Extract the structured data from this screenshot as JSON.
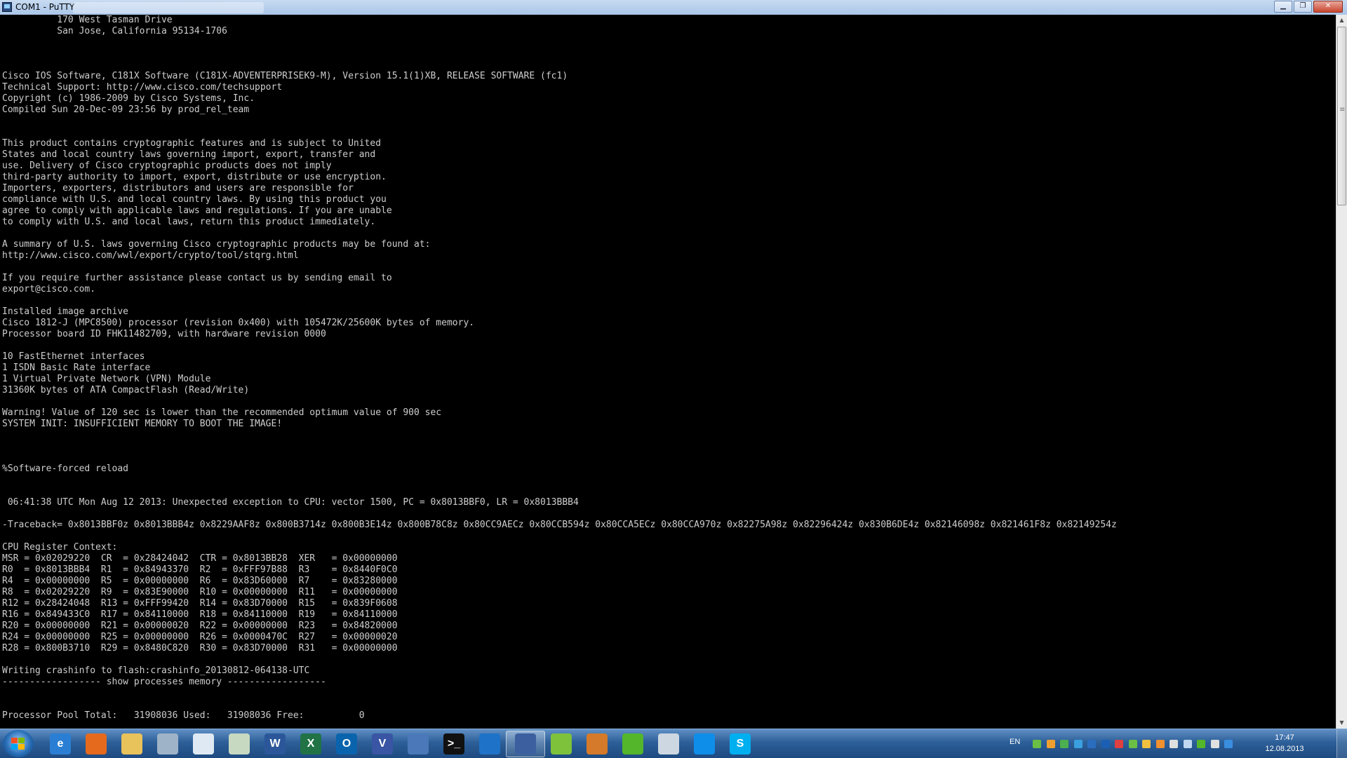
{
  "window": {
    "title": "COM1 - PuTTY"
  },
  "terminal": {
    "lines": [
      "          170 West Tasman Drive",
      "          San Jose, California 95134-1706",
      "",
      "",
      "",
      "Cisco IOS Software, C181X Software (C181X-ADVENTERPRISEK9-M), Version 15.1(1)XB, RELEASE SOFTWARE (fc1)",
      "Technical Support: http://www.cisco.com/techsupport",
      "Copyright (c) 1986-2009 by Cisco Systems, Inc.",
      "Compiled Sun 20-Dec-09 23:56 by prod_rel_team",
      "",
      "",
      "This product contains cryptographic features and is subject to United",
      "States and local country laws governing import, export, transfer and",
      "use. Delivery of Cisco cryptographic products does not imply",
      "third-party authority to import, export, distribute or use encryption.",
      "Importers, exporters, distributors and users are responsible for",
      "compliance with U.S. and local country laws. By using this product you",
      "agree to comply with applicable laws and regulations. If you are unable",
      "to comply with U.S. and local laws, return this product immediately.",
      "",
      "A summary of U.S. laws governing Cisco cryptographic products may be found at:",
      "http://www.cisco.com/wwl/export/crypto/tool/stqrg.html",
      "",
      "If you require further assistance please contact us by sending email to",
      "export@cisco.com.",
      "",
      "Installed image archive",
      "Cisco 1812-J (MPC8500) processor (revision 0x400) with 105472K/25600K bytes of memory.",
      "Processor board ID FHK11482709, with hardware revision 0000",
      "",
      "10 FastEthernet interfaces",
      "1 ISDN Basic Rate interface",
      "1 Virtual Private Network (VPN) Module",
      "31360K bytes of ATA CompactFlash (Read/Write)",
      "",
      "Warning! Value of 120 sec is lower than the recommended optimum value of 900 sec",
      "SYSTEM INIT: INSUFFICIENT MEMORY TO BOOT THE IMAGE!",
      "",
      "",
      "",
      "%Software-forced reload",
      "",
      "",
      " 06:41:38 UTC Mon Aug 12 2013: Unexpected exception to CPU: vector 1500, PC = 0x8013BBF0, LR = 0x8013BBB4",
      "",
      "-Traceback= 0x8013BBF0z 0x8013BBB4z 0x8229AAF8z 0x800B3714z 0x800B3E14z 0x800B78C8z 0x80CC9AECz 0x80CCB594z 0x80CCA5ECz 0x80CCA970z 0x82275A98z 0x82296424z 0x830B6DE4z 0x82146098z 0x821461F8z 0x82149254z",
      "",
      "CPU Register Context:",
      "MSR = 0x02029220  CR  = 0x28424042  CTR = 0x8013BB28  XER   = 0x00000000",
      "R0  = 0x8013BBB4  R1  = 0x84943370  R2  = 0xFFF97B88  R3    = 0x8440F0C0",
      "R4  = 0x00000000  R5  = 0x00000000  R6  = 0x83D60000  R7    = 0x83280000",
      "R8  = 0x02029220  R9  = 0x83E90000  R10 = 0x00000000  R11   = 0x00000000",
      "R12 = 0x28424048  R13 = 0xFFF99420  R14 = 0x83D70000  R15   = 0x839F0608",
      "R16 = 0x849433C0  R17 = 0x84110000  R18 = 0x84110000  R19   = 0x84110000",
      "R20 = 0x00000000  R21 = 0x00000020  R22 = 0x00000000  R23   = 0x84820000",
      "R24 = 0x00000000  R25 = 0x00000000  R26 = 0x0000470C  R27   = 0x00000020",
      "R28 = 0x800B3710  R29 = 0x8480C820  R30 = 0x83D70000  R31   = 0x00000000",
      "",
      "Writing crashinfo to flash:crashinfo_20130812-064138-UTC",
      "------------------ show processes memory ------------------",
      "",
      "",
      "Processor Pool Total:   31908036 Used:   31908036 Free:          0"
    ]
  },
  "taskbar": {
    "apps": [
      {
        "name": "internet-explorer",
        "glyph": "e",
        "color": "#2a7fd4",
        "active": false
      },
      {
        "name": "firefox",
        "glyph": "",
        "color": "#e56a1e",
        "active": false
      },
      {
        "name": "windows-explorer",
        "glyph": "",
        "color": "#e8c25a",
        "active": false
      },
      {
        "name": "snipping-tool",
        "glyph": "",
        "color": "#9fb3c8",
        "active": false
      },
      {
        "name": "notepad",
        "glyph": "",
        "color": "#dfe9f3",
        "active": false
      },
      {
        "name": "notes",
        "glyph": "",
        "color": "#c7d9c1",
        "active": false
      },
      {
        "name": "word",
        "glyph": "W",
        "color": "#2b579a",
        "active": false
      },
      {
        "name": "excel",
        "glyph": "X",
        "color": "#217346",
        "active": false
      },
      {
        "name": "outlook",
        "glyph": "O",
        "color": "#0a64ad",
        "active": false
      },
      {
        "name": "visio",
        "glyph": "V",
        "color": "#3955a3",
        "active": false
      },
      {
        "name": "remote-desktop",
        "glyph": "",
        "color": "#4a78b8",
        "active": false
      },
      {
        "name": "command-prompt",
        "glyph": ">_",
        "color": "#111111",
        "active": false
      },
      {
        "name": "onedrive",
        "glyph": "",
        "color": "#1e73c8",
        "active": false
      },
      {
        "name": "putty",
        "glyph": "",
        "color": "#3c5fa0",
        "active": true
      },
      {
        "name": "network-tool",
        "glyph": "",
        "color": "#7ec23c",
        "active": false
      },
      {
        "name": "rdp-manager",
        "glyph": "",
        "color": "#d47a2a",
        "active": false
      },
      {
        "name": "icq",
        "glyph": "",
        "color": "#54b62a",
        "active": false
      },
      {
        "name": "calculator",
        "glyph": "",
        "color": "#cdd7e2",
        "active": false
      },
      {
        "name": "teamviewer",
        "glyph": "",
        "color": "#0e8ee9",
        "active": false
      },
      {
        "name": "skype",
        "glyph": "S",
        "color": "#00aff0",
        "active": false
      }
    ]
  },
  "tray": {
    "language": "EN",
    "icons": [
      {
        "name": "tray-app-1-icon",
        "color": "#6bbf45"
      },
      {
        "name": "tray-app-2-icon",
        "color": "#f0a030"
      },
      {
        "name": "tray-app-3-icon",
        "color": "#4caf50"
      },
      {
        "name": "tray-app-4-icon",
        "color": "#3aa0e0"
      },
      {
        "name": "tray-app-5-icon",
        "color": "#2a6ec0"
      },
      {
        "name": "tray-outlook-icon",
        "color": "#1a5fb4"
      },
      {
        "name": "tray-app-7-icon",
        "color": "#e04040"
      },
      {
        "name": "tray-app-8-icon",
        "color": "#6bbf45"
      },
      {
        "name": "tray-app-9-icon",
        "color": "#f0c040"
      },
      {
        "name": "tray-app-10-icon",
        "color": "#f09030"
      },
      {
        "name": "tray-action-center-icon",
        "color": "#e0e0e0"
      },
      {
        "name": "tray-network-icon",
        "color": "#c0d8f0"
      },
      {
        "name": "tray-icq-icon",
        "color": "#54b62a"
      },
      {
        "name": "tray-volume-icon",
        "color": "#e0e0e0"
      },
      {
        "name": "tray-bluetooth-icon",
        "color": "#3a8ee0"
      }
    ],
    "time": "17:47",
    "date": "12.08.2013"
  }
}
